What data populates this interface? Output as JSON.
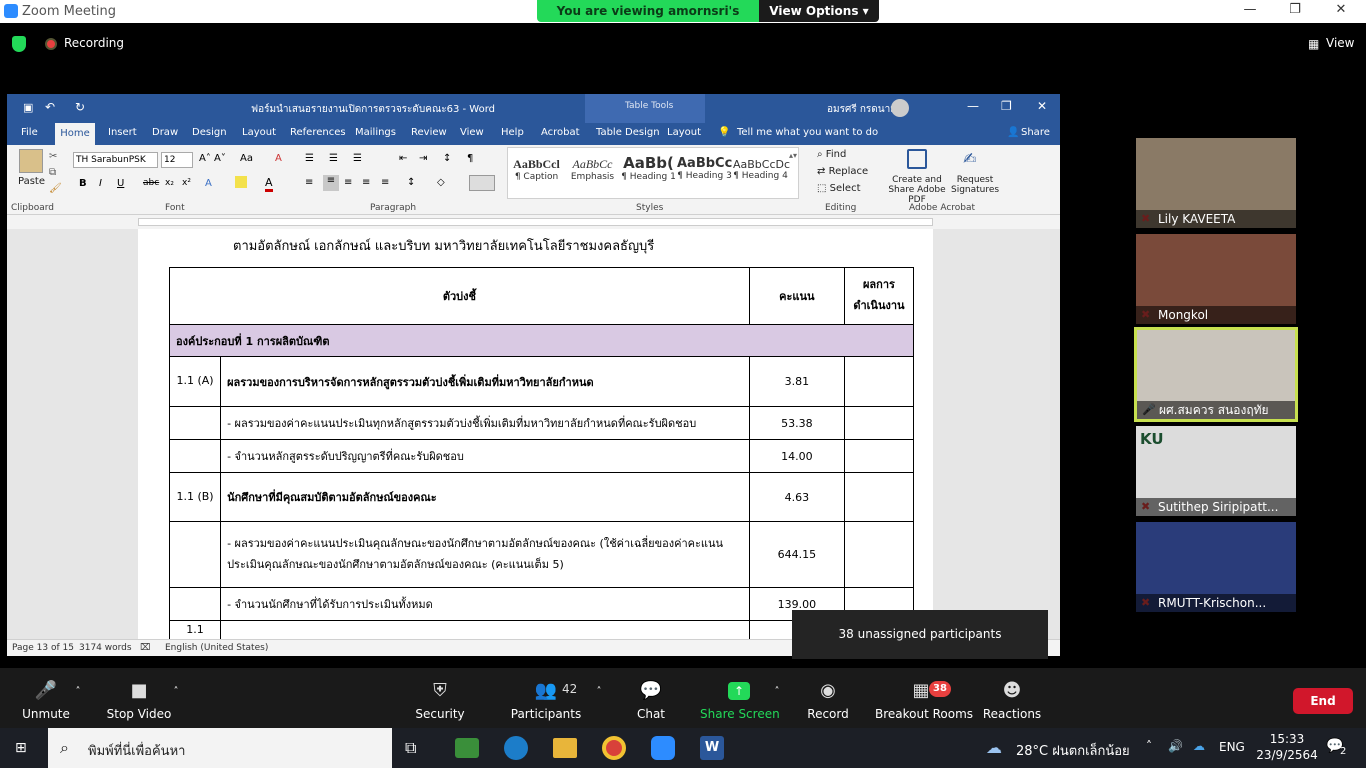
{
  "zoom": {
    "window_title": "Zoom Meeting",
    "banner_text": "You are viewing amornsri's screen",
    "view_options": "View Options",
    "recording": "Recording",
    "view": "View"
  },
  "word": {
    "doc_title": "ฟอร์มนำเสนอรายงานเปิดการตรวจระดับคณะ63 - Word",
    "table_tools": "Table Tools",
    "user_name": "อมรศรี กรดนาม",
    "tabs": [
      "File",
      "Home",
      "Insert",
      "Draw",
      "Design",
      "Layout",
      "References",
      "Mailings",
      "Review",
      "View",
      "Help",
      "Acrobat",
      "Table Design",
      "Layout"
    ],
    "tell_me": "Tell me what you want to do",
    "share": "Share",
    "font_name": "TH SarabunPSK",
    "font_size": "12",
    "groups": [
      "Clipboard",
      "Font",
      "Paragraph",
      "Styles",
      "Editing",
      "Adobe Acrobat"
    ],
    "paste": "Paste",
    "styles": [
      {
        "sample": "AaBbCcl",
        "name": "¶ Caption"
      },
      {
        "sample": "AaBbCc",
        "name": "Emphasis"
      },
      {
        "sample": "AaBb(",
        "name": "¶ Heading 1"
      },
      {
        "sample": "AaBbCc",
        "name": "¶ Heading 3"
      },
      {
        "sample": "AaBbCcDc",
        "name": "¶ Heading 4"
      }
    ],
    "editing": [
      "Find",
      "Replace",
      "Select"
    ],
    "acrobat": [
      "Create and Share Adobe PDF",
      "Request Signatures"
    ],
    "status": {
      "page": "Page 13 of 15",
      "words": "3174 words",
      "language": "English (United States)"
    }
  },
  "document": {
    "heading_line": "ตามอัตลักษณ์ เอกลักษณ์ และบริบท มหาวิทยาลัยเทคโนโลยีราชมงคลธัญบุรี",
    "col_indicator": "ตัวบ่งชี้",
    "col_score": "คะแนน",
    "col_result": "ผลการดำเนินงาน",
    "section": "องค์ประกอบที่ 1 การผลิตบัณฑิต",
    "rows": [
      {
        "no": "1.1 (A)",
        "text": "ผลรวมของการบริหารจัดการหลักสูตรรวมตัวบ่งชี้เพิ่มเติมที่มหาวิทยาลัยกำหนด",
        "score": "3.81",
        "bold": true
      },
      {
        "no": "",
        "text": "- ผลรวมของค่าคะแนนประเมินทุกหลักสูตรรวมตัวบ่งชี้เพิ่มเติมที่มหาวิทยาลัยกำหนดที่คณะรับผิดชอบ",
        "score": "53.38",
        "bold": false
      },
      {
        "no": "",
        "text": "- จำนวนหลักสูตรระดับปริญญาตรีที่คณะรับผิดชอบ",
        "score": "14.00",
        "bold": false
      },
      {
        "no": "1.1 (B)",
        "text": "นักศึกษาที่มีคุณสมบัติตามอัตลักษณ์ของคณะ",
        "score": "4.63",
        "bold": true
      },
      {
        "no": "",
        "text": "- ผลรวมของค่าคะแนนประเมินคุณลักษณะของนักศึกษาตามอัตลักษณ์ของคณะ (ใช้ค่าเฉลี่ยของค่าคะแนนประเมินคุณลักษณะของนักศึกษาตามอัตลักษณ์ของคณะ (คะแนนเต็ม 5)",
        "score": "644.15",
        "bold": false
      },
      {
        "no": "",
        "text": "- จำนวนนักศึกษาที่ได้รับการประเมินทั้งหมด",
        "score": "139.00",
        "bold": false
      },
      {
        "no": "1.1",
        "text": "",
        "score": "",
        "bold": false
      }
    ]
  },
  "participants": [
    {
      "name": "Lily KAVEETA",
      "bg": "#8a7a66"
    },
    {
      "name": "Mongkol",
      "bg": "#7a4a3a"
    },
    {
      "name": "ผศ.สมควร สนองฤทัย",
      "bg": "#c9c4bb"
    },
    {
      "name": "Sutithep Siripipatt...",
      "bg": "#dcdcdc"
    },
    {
      "name": "RMUTT-Krischon...",
      "bg": "#2a3c7a"
    }
  ],
  "toolbar": {
    "unmute": "Unmute",
    "stop_video": "Stop Video",
    "security": "Security",
    "participants": "Participants",
    "participants_count": "42",
    "chat": "Chat",
    "share_screen": "Share Screen",
    "record": "Record",
    "breakout_rooms": "Breakout Rooms",
    "breakout_badge": "38",
    "reactions": "Reactions",
    "end": "End",
    "unassigned": "38 unassigned participants"
  },
  "taskbar": {
    "search_placeholder": "พิมพ์ที่นี่เพื่อค้นหา",
    "weather": "28°C ฝนตกเล็กน้อย",
    "lang": "ENG",
    "time": "15:33",
    "date": "23/9/2564",
    "notif_count": "2"
  }
}
